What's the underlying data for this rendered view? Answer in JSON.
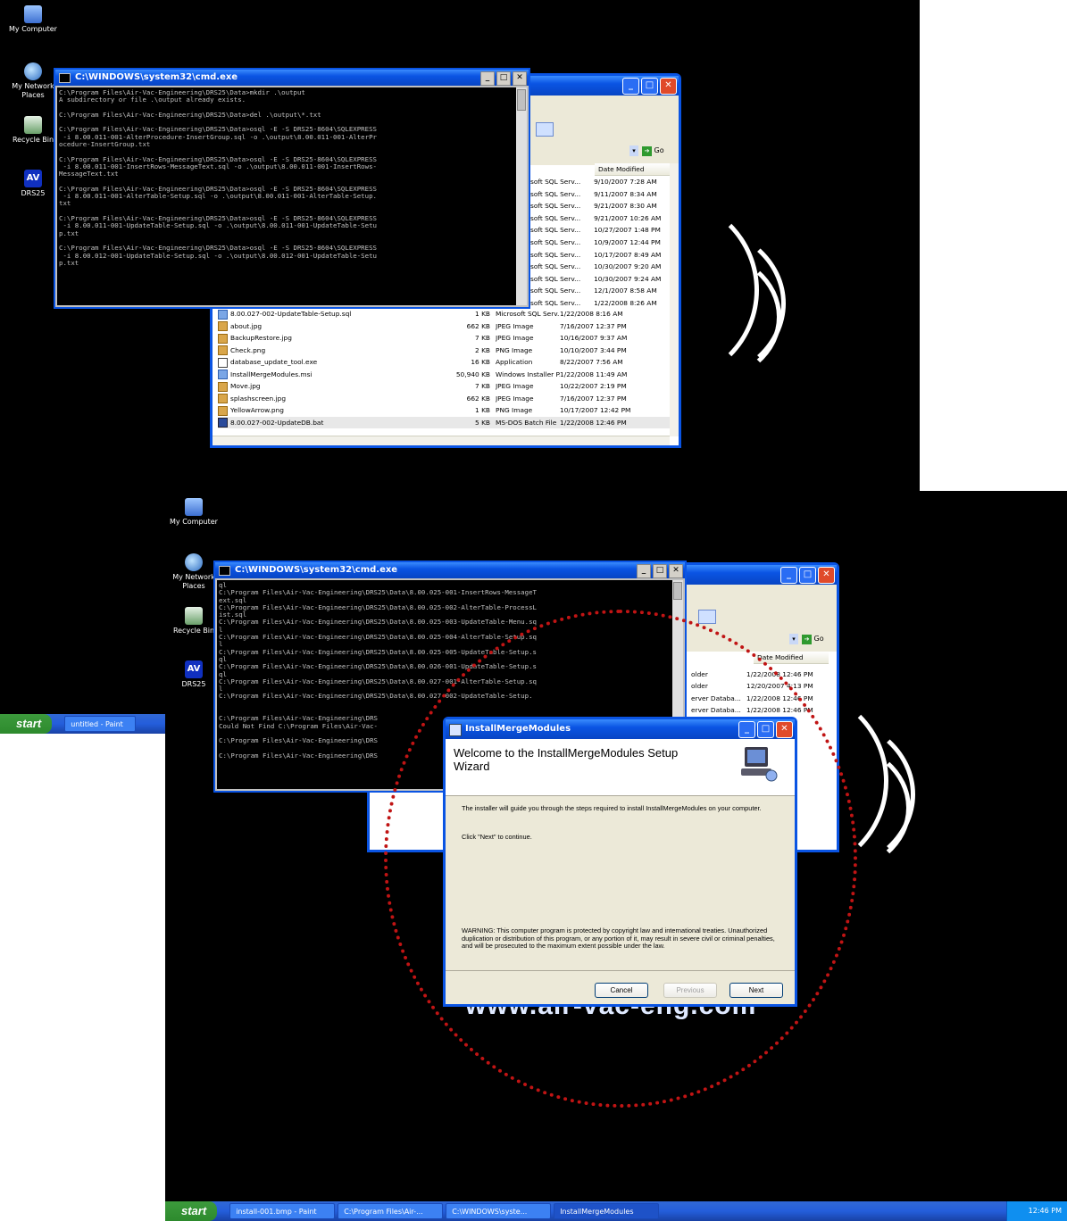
{
  "desktop_icons": [
    "My Computer",
    "My Network Places",
    "Recycle Bin",
    "DRS25"
  ],
  "brand_url": "www.air-vac-eng.com",
  "cmd": {
    "title": "C:\\WINDOWS\\system32\\cmd.exe",
    "lines1": [
      "C:\\Program Files\\Air-Vac-Engineering\\DRS25\\Data>mkdir .\\output",
      "A subdirectory or file .\\output already exists.",
      "",
      "C:\\Program Files\\Air-Vac-Engineering\\DRS25\\Data>del .\\output\\*.txt",
      "",
      "C:\\Program Files\\Air-Vac-Engineering\\DRS25\\Data>osql -E -S DRS25-8604\\SQLEXPRESS",
      " -i 8.00.011-001-AlterProcedure-InsertGroup.sql -o .\\output\\8.00.011-001-AlterPr",
      "ocedure-InsertGroup.txt",
      "",
      "C:\\Program Files\\Air-Vac-Engineering\\DRS25\\Data>osql -E -S DRS25-8604\\SQLEXPRESS",
      " -i 8.00.011-001-InsertRows-MessageText.sql -o .\\output\\8.00.011-001-InsertRows-",
      "MessageText.txt",
      "",
      "C:\\Program Files\\Air-Vac-Engineering\\DRS25\\Data>osql -E -S DRS25-8604\\SQLEXPRESS",
      " -i 8.00.011-001-AlterTable-Setup.sql -o .\\output\\8.00.011-001-AlterTable-Setup.",
      "txt",
      "",
      "C:\\Program Files\\Air-Vac-Engineering\\DRS25\\Data>osql -E -S DRS25-8604\\SQLEXPRESS",
      " -i 8.00.011-001-UpdateTable-Setup.sql -o .\\output\\8.00.011-001-UpdateTable-Setu",
      "p.txt",
      "",
      "C:\\Program Files\\Air-Vac-Engineering\\DRS25\\Data>osql -E -S DRS25-8604\\SQLEXPRESS",
      " -i 8.00.012-001-UpdateTable-Setup.sql -o .\\output\\8.00.012-001-UpdateTable-Setu",
      "p.txt"
    ],
    "lines2": [
      "ql",
      "C:\\Program Files\\Air-Vac-Engineering\\DRS25\\Data\\8.00.025-001-InsertRows-MessageT",
      "ext.sql",
      "C:\\Program Files\\Air-Vac-Engineering\\DRS25\\Data\\8.00.025-002-AlterTable-ProcessL",
      "ist.sql",
      "C:\\Program Files\\Air-Vac-Engineering\\DRS25\\Data\\8.00.025-003-UpdateTable-Menu.sq",
      "l",
      "C:\\Program Files\\Air-Vac-Engineering\\DRS25\\Data\\8.00.025-004-AlterTable-Setup.sq",
      "l",
      "C:\\Program Files\\Air-Vac-Engineering\\DRS25\\Data\\8.00.025-005-UpdateTable-Setup.s",
      "ql",
      "C:\\Program Files\\Air-Vac-Engineering\\DRS25\\Data\\8.00.026-001-UpdateTable-Setup.s",
      "ql",
      "C:\\Program Files\\Air-Vac-Engineering\\DRS25\\Data\\8.00.027-001-AlterTable-Setup.sq",
      "l",
      "C:\\Program Files\\Air-Vac-Engineering\\DRS25\\Data\\8.00.027-002-UpdateTable-Setup.",
      "",
      "",
      "C:\\Program Files\\Air-Vac-Engineering\\DRS",
      "Could Not Find C:\\Program Files\\Air-Vac-",
      "",
      "C:\\Program Files\\Air-Vac-Engineering\\DRS",
      "",
      "C:\\Program Files\\Air-Vac-Engineering\\DRS"
    ]
  },
  "explorer1": {
    "go_label": "Go",
    "col_date": "Date Modified",
    "partial_rows": [
      {
        "type": "soft SQL Serv...",
        "date": "9/10/2007 7:28 AM"
      },
      {
        "type": "soft SQL Serv...",
        "date": "9/11/2007 8:34 AM"
      },
      {
        "type": "soft SQL Serv...",
        "date": "9/21/2007 8:30 AM"
      },
      {
        "type": "soft SQL Serv...",
        "date": "9/21/2007 10:26 AM"
      },
      {
        "type": "soft SQL Serv...",
        "date": "10/27/2007 1:48 PM"
      },
      {
        "type": "soft SQL Serv...",
        "date": "10/9/2007 12:44 PM"
      },
      {
        "type": "soft SQL Serv...",
        "date": "10/17/2007 8:49 AM"
      },
      {
        "type": "soft SQL Serv...",
        "date": "10/30/2007 9:20 AM"
      },
      {
        "type": "soft SQL Serv...",
        "date": "10/30/2007 9:24 AM"
      },
      {
        "type": "soft SQL Serv...",
        "date": "12/1/2007 8:58 AM"
      },
      {
        "type": "soft SQL Serv...",
        "date": "1/22/2008 8:26 AM"
      }
    ],
    "rows": [
      {
        "name": "8.00.027-002-UpdateTable-Setup.sql",
        "size": "1 KB",
        "type": "Microsoft SQL Serv...",
        "date": "1/22/2008 8:16 AM",
        "icon": "sql"
      },
      {
        "name": "about.jpg",
        "size": "662 KB",
        "type": "JPEG Image",
        "date": "7/16/2007 12:37 PM",
        "icon": "img"
      },
      {
        "name": "BackupRestore.jpg",
        "size": "7 KB",
        "type": "JPEG Image",
        "date": "10/16/2007 9:37 AM",
        "icon": "img"
      },
      {
        "name": "Check.png",
        "size": "2 KB",
        "type": "PNG Image",
        "date": "10/10/2007 3:44 PM",
        "icon": "img"
      },
      {
        "name": "database_update_tool.exe",
        "size": "16 KB",
        "type": "Application",
        "date": "8/22/2007 7:56 AM",
        "icon": "exe"
      },
      {
        "name": "InstallMergeModules.msi",
        "size": "50,940 KB",
        "type": "Windows Installer P...",
        "date": "1/22/2008 11:49 AM",
        "icon": "sql"
      },
      {
        "name": "Move.jpg",
        "size": "7 KB",
        "type": "JPEG Image",
        "date": "10/22/2007 2:19 PM",
        "icon": "img"
      },
      {
        "name": "splashscreen.jpg",
        "size": "662 KB",
        "type": "JPEG Image",
        "date": "7/16/2007 12:37 PM",
        "icon": "img"
      },
      {
        "name": "YellowArrow.png",
        "size": "1 KB",
        "type": "PNG Image",
        "date": "10/17/2007 12:42 PM",
        "icon": "img"
      },
      {
        "name": "8.00.027-002-UpdateDB.bat",
        "size": "5 KB",
        "type": "MS-DOS Batch File",
        "date": "1/22/2008 12:46 PM",
        "icon": "bat"
      }
    ]
  },
  "explorer2": {
    "go_label": "Go",
    "col_date": "Date Modified",
    "rows": [
      {
        "type": "older",
        "date": "1/22/2008 12:46 PM"
      },
      {
        "type": "older",
        "date": "12/20/2007 4:13 PM"
      },
      {
        "type": "erver Databa...",
        "date": "1/22/2008 12:46 PM"
      },
      {
        "type": "erver Databa...",
        "date": "1/22/2008 12:46 PM"
      },
      {
        "type": "",
        "date": "AM"
      },
      {
        "type": "",
        "date": "46 PM"
      }
    ]
  },
  "wizard": {
    "title": "InstallMergeModules",
    "heading": "Welcome to the InstallMergeModules Setup Wizard",
    "intro": "The installer will guide you through the steps required to install InstallMergeModules on your computer.",
    "click_next": "Click \"Next\" to continue.",
    "warning": "WARNING: This computer program is protected by copyright law and international treaties. Unauthorized duplication or distribution of this program, or any portion of it, may result in severe civil or criminal penalties, and will be prosecuted to the maximum extent possible under the law.",
    "cancel": "Cancel",
    "previous": "Previous",
    "next": "Next"
  },
  "taskbar1": {
    "start": "start",
    "items": [
      "untitled - Paint"
    ]
  },
  "taskbar2": {
    "start": "start",
    "items": [
      "install-001.bmp - Paint",
      "C:\\Program Files\\Air-...",
      "C:\\WINDOWS\\syste...",
      "InstallMergeModules"
    ],
    "clock": "12:46 PM"
  },
  "colors": {
    "annotation_ring": "#c01414",
    "xp_blue": "#0a54e3",
    "desktop": "#000000"
  }
}
